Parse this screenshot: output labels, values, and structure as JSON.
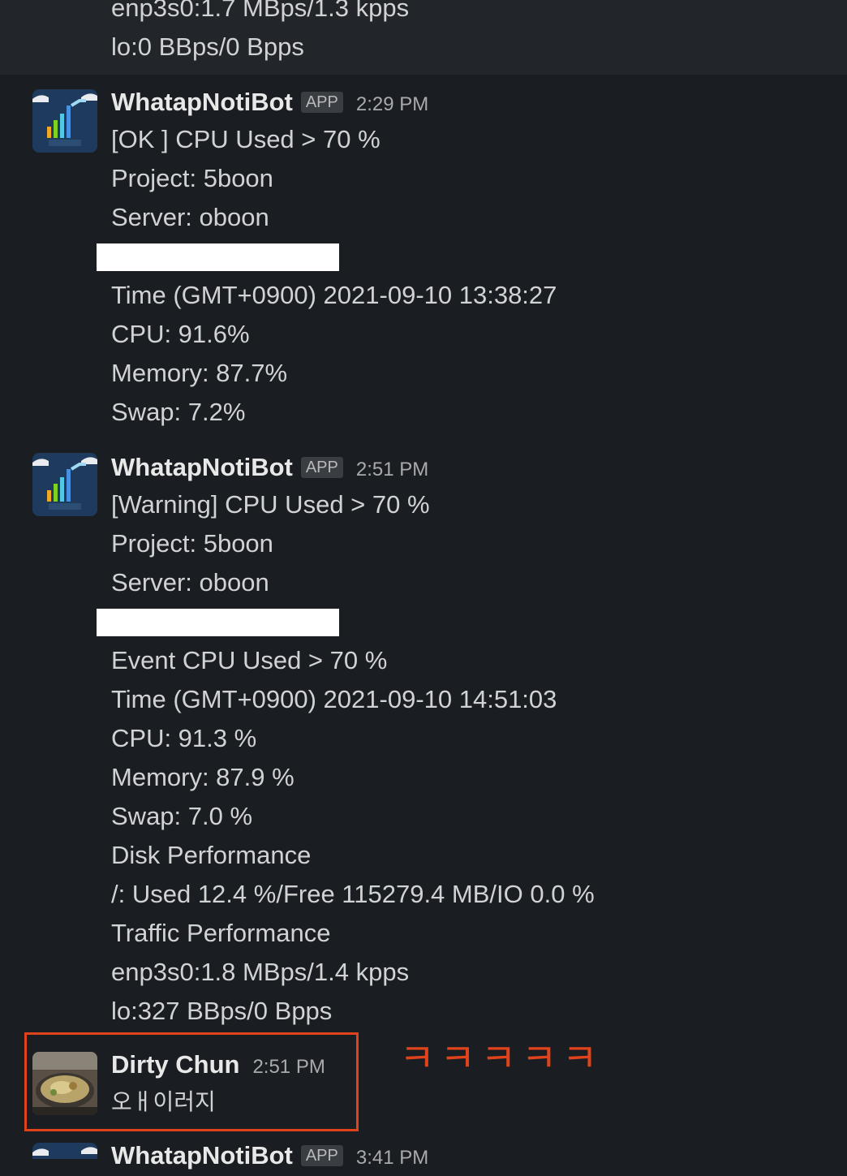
{
  "top_message": {
    "lines": [
      "enp3s0:1.7 MBps/1.3 kpps",
      "lo:0 BBps/0 Bpps"
    ]
  },
  "messages": [
    {
      "name": "WhatapNotiBot",
      "badge": "APP",
      "time": "2:29 PM",
      "lines_a": [
        "[OK ] CPU Used > 70 %",
        "Project: 5boon",
        "Server: oboon"
      ],
      "lines_b": [
        "Time  (GMT+0900) 2021-09-10 13:38:27",
        "CPU: 91.6%",
        "Memory: 87.7%",
        "Swap: 7.2%"
      ]
    },
    {
      "name": "WhatapNotiBot",
      "badge": "APP",
      "time": "2:51 PM",
      "lines_a": [
        "[Warning] CPU Used > 70 %",
        "Project: 5boon",
        "Server: oboon"
      ],
      "lines_b": [
        "Event CPU Used > 70 %",
        "Time  (GMT+0900) 2021-09-10 14:51:03",
        "CPU: 91.3 %",
        "Memory: 87.9 %",
        "Swap: 7.0 %",
        "Disk Performance",
        "/: Used 12.4 %/Free 115279.4 MB/IO 0.0 %",
        "Traffic Performance",
        "enp3s0:1.8 MBps/1.4 kpps",
        "lo:327 BBps/0 Bpps"
      ]
    },
    {
      "name": "Dirty Chun",
      "time": "2:51 PM",
      "text": "오ㅐ이러지"
    },
    {
      "name": "WhatapNotiBot",
      "badge": "APP",
      "time": "3:41 PM"
    }
  ],
  "annotation": {
    "text": "ㅋㅋㅋㅋㅋ",
    "color": "#e0431b"
  },
  "icons": {
    "bot_avatar": "whatap-chart-icon",
    "user_avatar": "food-photo-avatar"
  }
}
